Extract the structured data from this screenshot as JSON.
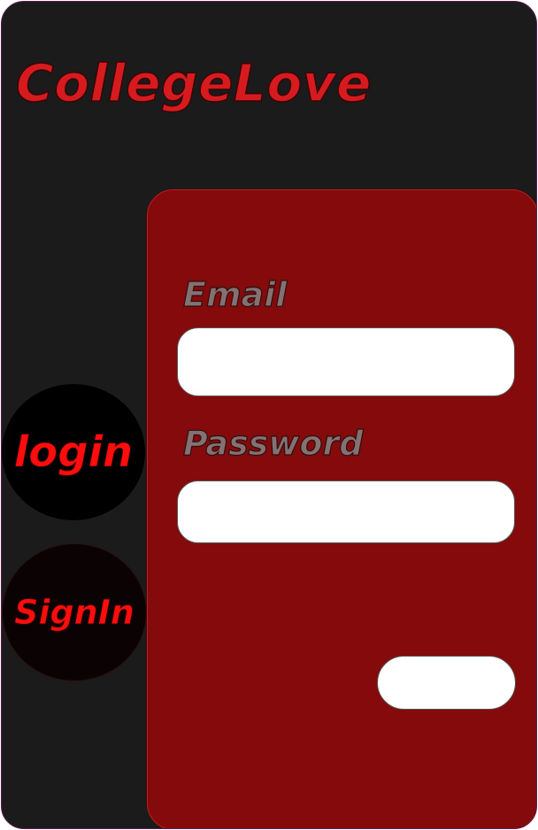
{
  "app": {
    "brand": "CollegeLove"
  },
  "tabs": {
    "login_label": "login",
    "signin_label": "SignIn"
  },
  "form": {
    "email_label": "Email",
    "email_value": "",
    "email_placeholder": "",
    "password_label": "Password",
    "password_value": "",
    "password_placeholder": "",
    "submit_label": ""
  },
  "colors": {
    "background": "#1b1b1b",
    "brand": "#d61b1f",
    "panel": "#850a0b",
    "tab_text": "#ff0d0d",
    "label_text": "#857172"
  }
}
